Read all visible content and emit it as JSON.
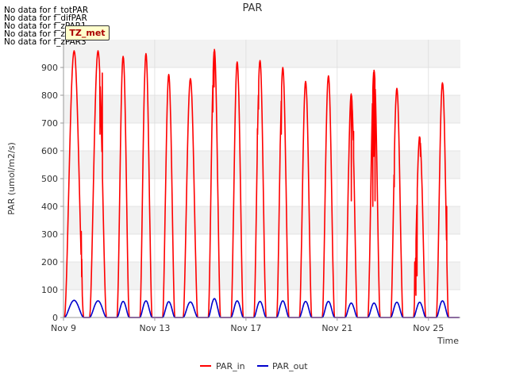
{
  "notes": [
    "No data for f_totPAR",
    "No data for f_difPAR",
    "No data for f_zPAR1",
    "No data for f_zPAR2",
    "No data for f_zPAR3"
  ],
  "badge": "TZ_met",
  "chart_data": {
    "type": "line",
    "title": "PAR",
    "xlabel": "Time",
    "ylabel": "PAR (umol/m2/s)",
    "xlim": [
      0,
      17.4
    ],
    "ylim": [
      0,
      1000
    ],
    "x_ticks": [
      {
        "x": 0,
        "label": "Nov 9"
      },
      {
        "x": 4,
        "label": "Nov 13"
      },
      {
        "x": 8,
        "label": "Nov 17"
      },
      {
        "x": 12,
        "label": "Nov 21"
      },
      {
        "x": 16,
        "label": "Nov 25"
      }
    ],
    "y_ticks": [
      0,
      100,
      200,
      300,
      400,
      500,
      600,
      700,
      800,
      900
    ],
    "grid": true,
    "legend_position": "bottom-center",
    "days": [
      {
        "start": 0.05,
        "end": 0.88,
        "peak": 960,
        "dips": [
          [
            0.78,
            310
          ],
          [
            0.8,
            210
          ]
        ],
        "out": 62
      },
      {
        "start": 1.15,
        "end": 1.88,
        "peak": 960,
        "dips": [
          [
            1.6,
            660
          ],
          [
            1.7,
            880
          ]
        ],
        "out": 60
      },
      {
        "start": 2.35,
        "end": 2.88,
        "peak": 940,
        "dips": [],
        "out": 58
      },
      {
        "start": 3.35,
        "end": 3.88,
        "peak": 950,
        "dips": [],
        "out": 60
      },
      {
        "start": 4.35,
        "end": 4.88,
        "peak": 875,
        "dips": [],
        "out": 57
      },
      {
        "start": 5.25,
        "end": 5.88,
        "peak": 860,
        "dips": [],
        "out": 56
      },
      {
        "start": 6.35,
        "end": 6.88,
        "peak": 965,
        "dips": [
          [
            6.55,
            740
          ],
          [
            6.6,
            830
          ]
        ],
        "out": 68
      },
      {
        "start": 7.35,
        "end": 7.88,
        "peak": 920,
        "dips": [],
        "out": 60
      },
      {
        "start": 8.35,
        "end": 8.88,
        "peak": 925,
        "dips": [
          [
            8.5,
            680
          ],
          [
            8.55,
            750
          ]
        ],
        "out": 58
      },
      {
        "start": 9.35,
        "end": 9.88,
        "peak": 900,
        "dips": [
          [
            9.5,
            620
          ],
          [
            9.55,
            660
          ]
        ],
        "out": 60
      },
      {
        "start": 10.35,
        "end": 10.88,
        "peak": 850,
        "dips": [],
        "out": 58
      },
      {
        "start": 11.35,
        "end": 11.88,
        "peak": 870,
        "dips": [],
        "out": 58
      },
      {
        "start": 12.35,
        "end": 12.88,
        "peak": 805,
        "dips": [
          [
            12.62,
            420
          ],
          [
            12.66,
            750
          ],
          [
            12.72,
            670
          ]
        ],
        "out": 52
      },
      {
        "start": 13.35,
        "end": 13.88,
        "peak": 890,
        "dips": [
          [
            13.56,
            400
          ],
          [
            13.6,
            580
          ],
          [
            13.66,
            420
          ]
        ],
        "out": 52
      },
      {
        "start": 14.35,
        "end": 14.88,
        "peak": 825,
        "dips": [
          [
            14.5,
            470
          ]
        ],
        "out": 55
      },
      {
        "start": 15.35,
        "end": 15.88,
        "peak": 650,
        "dips": [
          [
            15.4,
            200
          ],
          [
            15.45,
            80
          ],
          [
            15.5,
            150
          ],
          [
            15.6,
            650
          ],
          [
            15.65,
            580
          ]
        ],
        "out": 55
      },
      {
        "start": 16.35,
        "end": 16.88,
        "peak": 845,
        "dips": [
          [
            16.7,
            690
          ],
          [
            16.8,
            400
          ]
        ],
        "out": 60
      }
    ],
    "series": [
      {
        "name": "PAR_in",
        "color": "#ff0000"
      },
      {
        "name": "PAR_out",
        "color": "#0000cc"
      }
    ]
  }
}
